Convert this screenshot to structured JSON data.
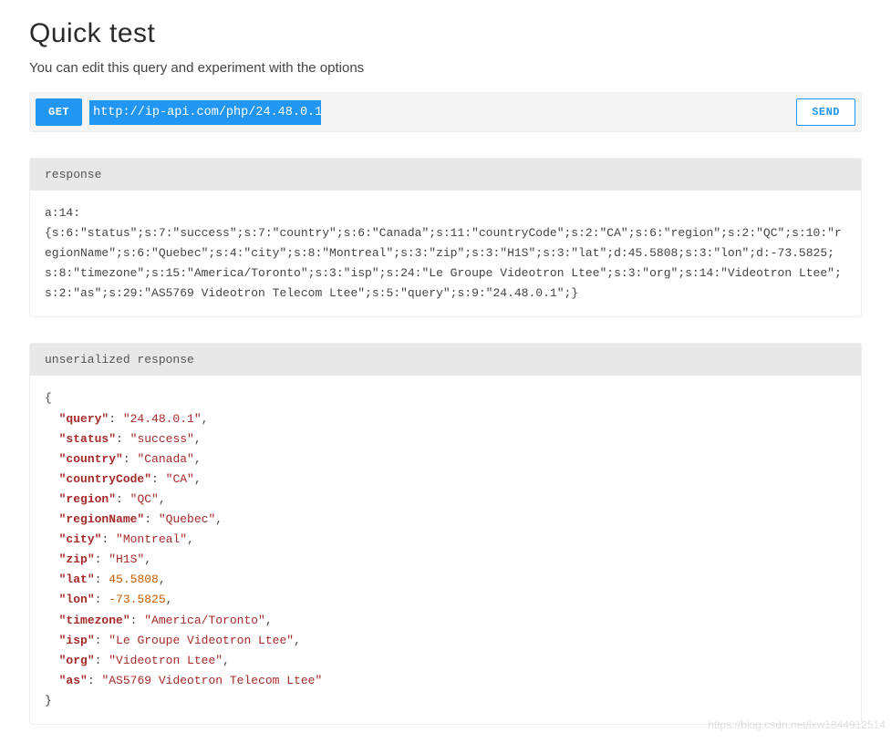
{
  "header": {
    "title": "Quick test",
    "subtitle": "You can edit this query and experiment with the options"
  },
  "query": {
    "method": "GET",
    "url": "http://ip-api.com/php/24.48.0.1",
    "send_label": "SEND"
  },
  "response_panel": {
    "label": "response",
    "raw": "a:14:\n{s:6:\"status\";s:7:\"success\";s:7:\"country\";s:6:\"Canada\";s:11:\"countryCode\";s:2:\"CA\";s:6:\"region\";s:2:\"QC\";s:10:\"regionName\";s:6:\"Quebec\";s:4:\"city\";s:8:\"Montreal\";s:3:\"zip\";s:3:\"H1S\";s:3:\"lat\";d:45.5808;s:3:\"lon\";d:-73.5825;s:8:\"timezone\";s:15:\"America/Toronto\";s:3:\"isp\";s:24:\"Le Groupe Videotron Ltee\";s:3:\"org\";s:14:\"Videotron Ltee\";s:2:\"as\";s:29:\"AS5769 Videotron Telecom Ltee\";s:5:\"query\";s:9:\"24.48.0.1\";}"
  },
  "unserialized_panel": {
    "label": "unserialized response",
    "entries": [
      {
        "key": "query",
        "value": "24.48.0.1",
        "type": "string"
      },
      {
        "key": "status",
        "value": "success",
        "type": "string"
      },
      {
        "key": "country",
        "value": "Canada",
        "type": "string"
      },
      {
        "key": "countryCode",
        "value": "CA",
        "type": "string"
      },
      {
        "key": "region",
        "value": "QC",
        "type": "string"
      },
      {
        "key": "regionName",
        "value": "Quebec",
        "type": "string"
      },
      {
        "key": "city",
        "value": "Montreal",
        "type": "string"
      },
      {
        "key": "zip",
        "value": "H1S",
        "type": "string"
      },
      {
        "key": "lat",
        "value": 45.5808,
        "type": "number"
      },
      {
        "key": "lon",
        "value": -73.5825,
        "type": "number"
      },
      {
        "key": "timezone",
        "value": "America/Toronto",
        "type": "string"
      },
      {
        "key": "isp",
        "value": "Le Groupe Videotron Ltee",
        "type": "string"
      },
      {
        "key": "org",
        "value": "Videotron Ltee",
        "type": "string"
      },
      {
        "key": "as",
        "value": "AS5769 Videotron Telecom Ltee",
        "type": "string"
      }
    ]
  },
  "watermark": "https://blog.csdn.net/lxw1844912514"
}
